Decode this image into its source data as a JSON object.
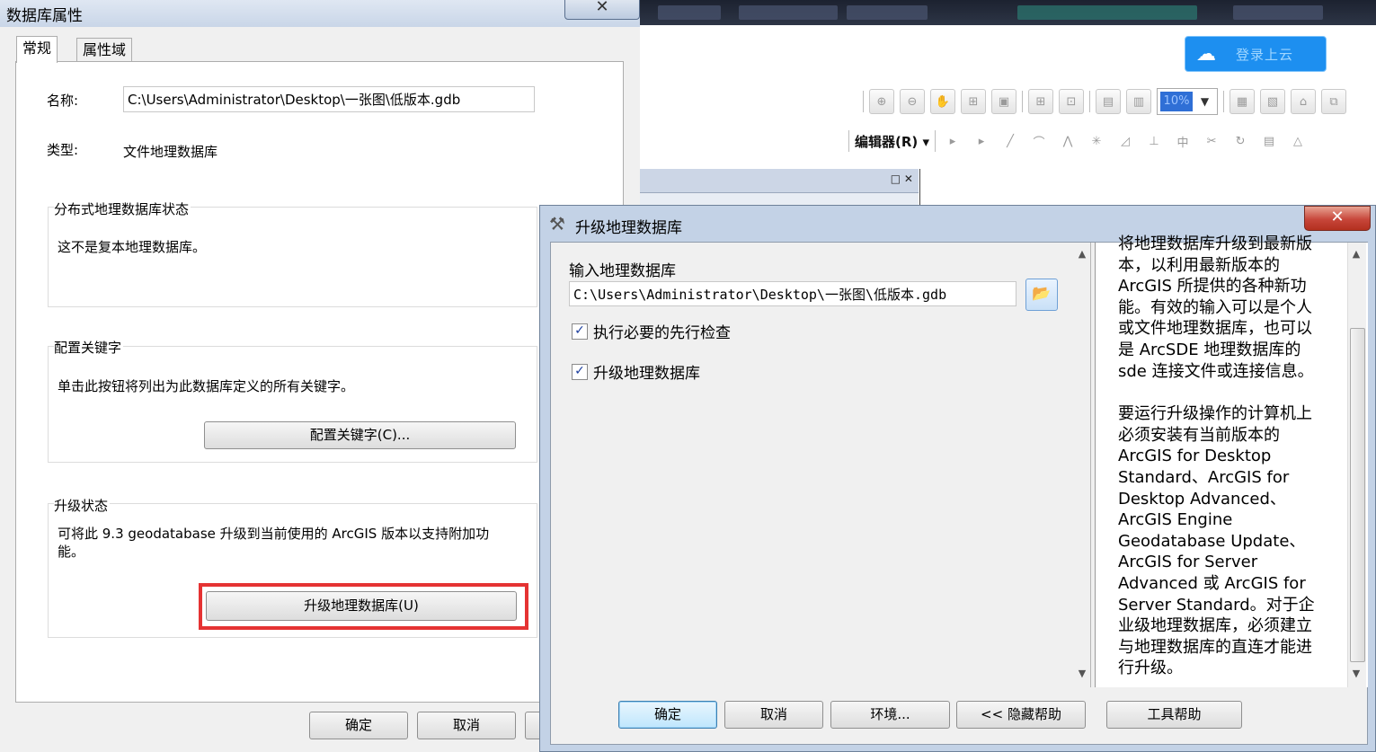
{
  "db_dialog": {
    "title": "数据库属性",
    "close_glyph": "✕",
    "tabs": [
      "常规",
      "属性域"
    ],
    "name_label": "名称:",
    "name_value": "C:\\Users\\Administrator\\Desktop\\一张图\\低版本.gdb",
    "type_label": "类型:",
    "type_value": "文件地理数据库",
    "distributed_group": {
      "title": "分布式地理数据库状态",
      "text": "这不是复本地理数据库。"
    },
    "keywords_group": {
      "title": "配置关键字",
      "text": "单击此按钮将列出为此数据库定义的所有关键字。",
      "button": "配置关键字(C)..."
    },
    "upgrade_group": {
      "title": "升级状态",
      "text_line1": "可将此 9.3 geodatabase 升级到当前使用的 ArcGIS 版本以支持附加功",
      "text_line2": "能。",
      "button": "升级地理数据库(U)"
    },
    "footer": {
      "ok": "确定",
      "cancel": "取消"
    },
    "highlight_color": "#e53333"
  },
  "upgrade_dialog": {
    "title": "升级地理数据库",
    "close_glyph": "✕",
    "input_label": "输入地理数据库",
    "input_value": "C:\\Users\\Administrator\\Desktop\\一张图\\低版本.gdb",
    "checkboxes": [
      {
        "label": "执行必要的先行检查",
        "checked": true
      },
      {
        "label": "升级地理数据库",
        "checked": true
      }
    ],
    "help_paragraph1_lines": [
      "将地理数据库升级到最新版",
      "本，以利用最新版本的",
      "ArcGIS 所提供的各种新功",
      "能。有效的输入可以是个人",
      "或文件地理数据库，也可以",
      "是 ArcSDE 地理数据库的",
      "sde 连接文件或连接信息。"
    ],
    "help_paragraph2_lines": [
      "要运行升级操作的计算机上",
      "必须安装有当前版本的",
      "ArcGIS for Desktop",
      "Standard、ArcGIS for",
      "Desktop Advanced、",
      "ArcGIS Engine",
      "Geodatabase Update、",
      "ArcGIS for Server",
      "Advanced 或 ArcGIS for",
      "Server Standard。对于企",
      "业级地理数据库，必须建立",
      "与地理数据库的直连才能进",
      "行升级。"
    ],
    "footer": {
      "ok": "确定",
      "cancel": "取消",
      "env": "环境...",
      "hide_help": "<< 隐藏帮助",
      "tool_help": "工具帮助"
    }
  },
  "background_app": {
    "editor_menu": "编辑器(R)",
    "cloud_button_text": "登录上云",
    "zoom_value": "10%"
  },
  "colors": {
    "title_active": "#c3d2e6",
    "close_red": "#c7463a",
    "cloud_blue": "#1d8ff0"
  }
}
